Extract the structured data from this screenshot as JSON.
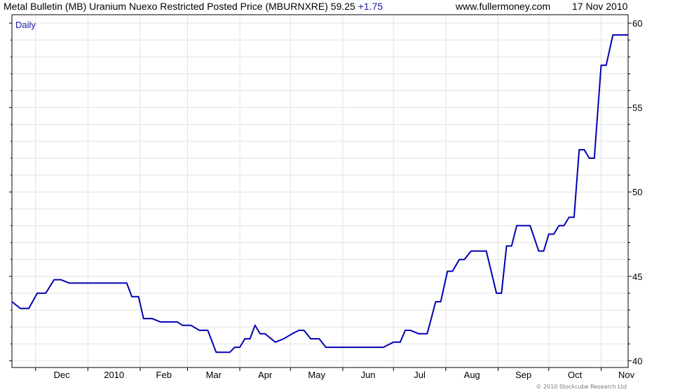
{
  "header": {
    "title": "Metal Bulletin (MB) Uranium Nuexo Restricted Posted Price (MBURNXRE) 59.25",
    "change": "+1.75",
    "site": "www.fullermoney.com",
    "date": "17 Nov 2010"
  },
  "credit": "© 2010 Stockcube Research Ltd",
  "colors": {
    "line": "#0000b4",
    "accent": "#1a1aa6",
    "grid": "#e2e2e2"
  },
  "chart_data": {
    "type": "line",
    "period_label": "Daily",
    "x_tick_labels": [
      "Dec",
      "2010",
      "Feb",
      "Mar",
      "Apr",
      "May",
      "Jun",
      "Jul",
      "Aug",
      "Sep",
      "Oct",
      "Nov"
    ],
    "y_ticks": [
      40,
      45,
      50,
      55,
      60
    ],
    "ylim": [
      39.6,
      60.5
    ],
    "xlim": [
      "2009-11-17",
      "2010-11-17"
    ],
    "grid": true,
    "y_axis_side": "right",
    "series": [
      {
        "x": [
          "2009-11-17",
          "2009-11-22",
          "2009-11-27",
          "2009-12-02",
          "2009-12-07",
          "2009-12-12",
          "2009-12-16",
          "2009-12-21",
          "2009-12-25",
          "2010-01-02",
          "2010-01-10",
          "2010-01-17",
          "2010-01-24",
          "2010-01-27",
          "2010-01-31",
          "2010-02-03",
          "2010-02-08",
          "2010-02-13",
          "2010-02-18",
          "2010-02-23",
          "2010-02-26",
          "2010-03-03",
          "2010-03-08",
          "2010-03-13",
          "2010-03-18",
          "2010-03-21",
          "2010-03-26",
          "2010-03-29",
          "2010-04-01",
          "2010-04-04",
          "2010-04-07",
          "2010-04-10",
          "2010-04-13",
          "2010-04-16",
          "2010-04-22",
          "2010-04-27",
          "2010-05-02",
          "2010-05-06",
          "2010-05-09",
          "2010-05-13",
          "2010-05-18",
          "2010-05-22",
          "2010-05-26",
          "2010-06-01",
          "2010-06-07",
          "2010-06-13",
          "2010-06-19",
          "2010-06-25",
          "2010-07-01",
          "2010-07-05",
          "2010-07-08",
          "2010-07-11",
          "2010-07-16",
          "2010-07-21",
          "2010-07-26",
          "2010-07-29",
          "2010-08-02",
          "2010-08-05",
          "2010-08-09",
          "2010-08-12",
          "2010-08-16",
          "2010-08-19",
          "2010-08-25",
          "2010-08-31",
          "2010-09-03",
          "2010-09-06",
          "2010-09-09",
          "2010-09-12",
          "2010-09-15",
          "2010-09-20",
          "2010-09-25",
          "2010-09-28",
          "2010-10-01",
          "2010-10-04",
          "2010-10-07",
          "2010-10-10",
          "2010-10-13",
          "2010-10-16",
          "2010-10-19",
          "2010-10-22",
          "2010-10-25",
          "2010-10-28",
          "2010-11-01",
          "2010-11-04",
          "2010-11-08",
          "2010-11-10",
          "2010-11-14",
          "2010-11-17"
        ],
        "y": [
          43.5,
          43.1,
          43.1,
          44.0,
          44.0,
          44.8,
          44.8,
          44.6,
          44.6,
          44.6,
          44.6,
          44.6,
          44.6,
          43.8,
          43.8,
          42.5,
          42.5,
          42.3,
          42.3,
          42.3,
          42.1,
          42.1,
          41.8,
          41.8,
          40.5,
          40.5,
          40.5,
          40.8,
          40.8,
          41.3,
          41.3,
          42.1,
          41.6,
          41.6,
          41.1,
          41.3,
          41.6,
          41.8,
          41.8,
          41.3,
          41.3,
          40.8,
          40.8,
          40.8,
          40.8,
          40.8,
          40.8,
          40.8,
          41.1,
          41.1,
          41.8,
          41.8,
          41.6,
          41.6,
          43.5,
          43.5,
          45.3,
          45.3,
          46.0,
          46.0,
          46.5,
          46.5,
          46.5,
          44.0,
          44.0,
          46.8,
          46.8,
          48.0,
          48.0,
          48.0,
          46.5,
          46.5,
          47.5,
          47.5,
          48.0,
          48.0,
          48.5,
          48.5,
          52.5,
          52.5,
          52.0,
          52.0,
          57.5,
          57.5,
          59.3,
          59.3,
          59.3,
          59.3
        ]
      }
    ]
  }
}
